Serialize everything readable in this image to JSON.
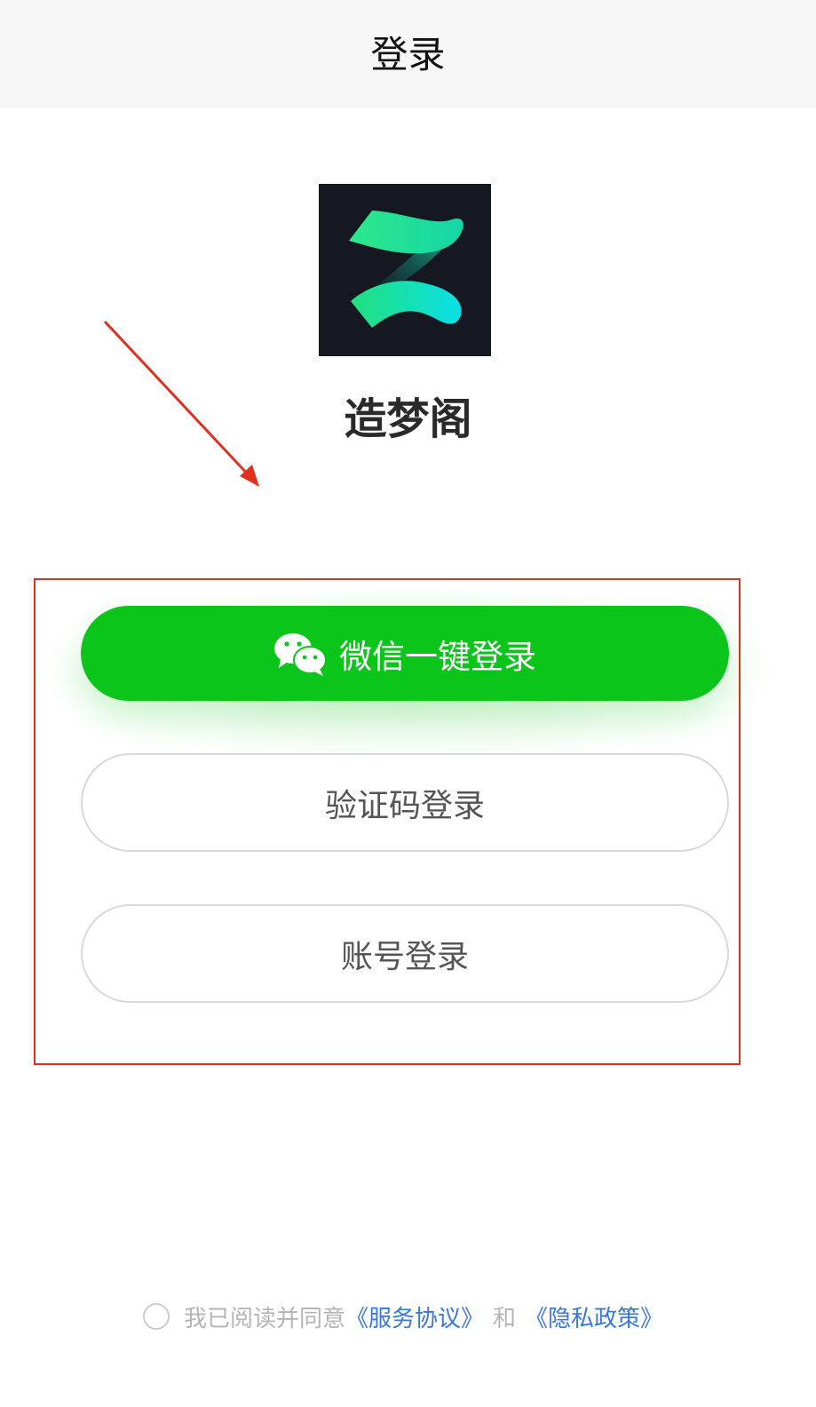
{
  "nav": {
    "title": "登录"
  },
  "app": {
    "name": "造梦阁",
    "logo_icon": "app-logo-z-icon"
  },
  "buttons": {
    "wechat_label": "微信一键登录",
    "wechat_icon": "wechat-icon",
    "sms_label": "验证码登录",
    "account_label": "账号登录"
  },
  "agreement": {
    "prefix": "我已阅读并同意",
    "service_link": "《服务协议》",
    "connector": "和",
    "privacy_link": "《隐私政策》"
  },
  "colors": {
    "wechat_green": "#0cc51b",
    "link_blue": "#3a78d8",
    "annotation_red": "#e0301e",
    "logo_bg": "#161821"
  }
}
